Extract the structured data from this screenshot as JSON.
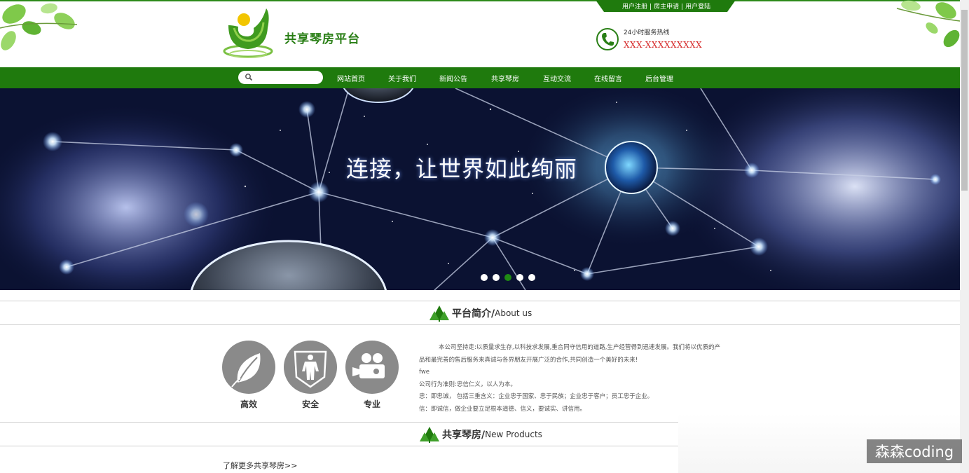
{
  "colors": {
    "brand_green": "#1f7a0d",
    "title_green": "#2a7f16",
    "hotline_red": "#d42020",
    "feature_gray": "#8a8a8a"
  },
  "header": {
    "user_links": [
      "用户注册",
      "房主申请",
      "用户登陆"
    ],
    "site_title": "共享琴房平台",
    "hotline_label": "24小时服务热线",
    "hotline_number": "XXX-XXXXXXXXX"
  },
  "nav": {
    "search_placeholder": "",
    "items": [
      "网站首页",
      "关于我们",
      "新闻公告",
      "共享琴房",
      "互动交流",
      "在线留言",
      "后台管理"
    ]
  },
  "banner": {
    "slogan": "连接，让世界如此绚丽",
    "slide_count": 5,
    "active_slide": 3
  },
  "about": {
    "title_cn": "平台简介/",
    "title_en": "About us",
    "features": [
      {
        "label": "高效",
        "icon": "leaf-icon"
      },
      {
        "label": "安全",
        "icon": "shield-person-icon"
      },
      {
        "label": "专业",
        "icon": "camera-icon"
      }
    ],
    "paragraphs": [
      "本公司坚持走:以质量求生存,以科技求发展,重合同守信用的道路,生产经营得到迅速发展。我们将以优质的产",
      "品和最完善的售后服务来真诚与各界朋友开展广泛的合作,共同创造一个美好的未来!",
      "fwe",
      "公司行为准则:忠信仁义，以人为本。",
      "忠：即忠诚， 包括三重含义：企业忠于国家、忠于民族；企业忠于客户；员工忠于企业。",
      "信：即诚信，做企业要立足根本道德、信义，要诚实、讲信用。"
    ]
  },
  "products": {
    "title_cn": "共享琴房/",
    "title_en": "New Products",
    "more_link": "了解更多共享琴房>>"
  },
  "watermark": "森森coding"
}
